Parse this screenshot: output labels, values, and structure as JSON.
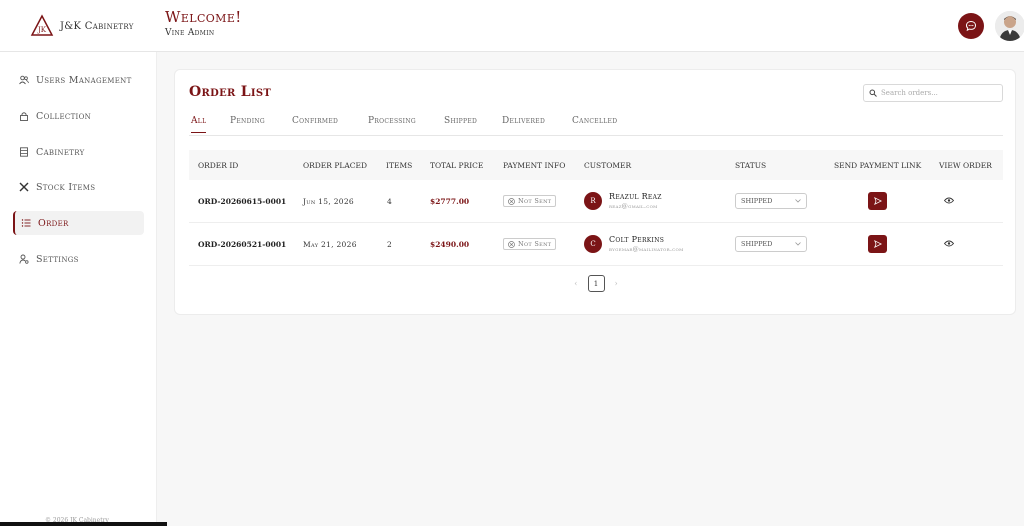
{
  "brand": {
    "name": "J&K Cabinetry"
  },
  "header": {
    "title": "Welcome!",
    "subtitle": "Vine Admin"
  },
  "sidebar": {
    "items": [
      {
        "label": "Users Management",
        "icon": "users-icon"
      },
      {
        "label": "Collection",
        "icon": "lock-icon"
      },
      {
        "label": "Cabinetry",
        "icon": "cabinet-icon"
      },
      {
        "label": "Stock Items",
        "icon": "tools-icon"
      },
      {
        "label": "Order",
        "icon": "list-icon",
        "active": true
      },
      {
        "label": "Settings",
        "icon": "user-settings-icon"
      }
    ],
    "footer": "© 2026 JK Cabinetry"
  },
  "main": {
    "title": "Order List",
    "search_placeholder": "Search orders...",
    "tabs": [
      "All",
      "Pending",
      "Confirmed",
      "Processing",
      "Shipped",
      "Delivered",
      "Cancelled"
    ],
    "active_tab": "All",
    "columns": [
      "ORDER ID",
      "ORDER PLACED",
      "ITEMS",
      "TOTAL PRICE",
      "PAYMENT INFO",
      "CUSTOMER",
      "STATUS",
      "SEND PAYMENT LINK",
      "VIEW ORDER"
    ],
    "rows": [
      {
        "order_id": "ORD-20260615-0001",
        "placed": "Jun 15, 2026",
        "items": "4",
        "total": "$2777.00",
        "payment": "Not Sent",
        "customer_initial": "R",
        "customer_name": "Reazul Reaz",
        "customer_email": "reaz@gmail.com",
        "status": "SHIPPED"
      },
      {
        "order_id": "ORD-20260521-0001",
        "placed": "May 21, 2026",
        "items": "2",
        "total": "$2490.00",
        "payment": "Not Sent",
        "customer_initial": "C",
        "customer_name": "Colt Perkins",
        "customer_email": "bygemar@mailinator.com",
        "status": "SHIPPED"
      }
    ],
    "pagination": {
      "current": "1",
      "prev": "‹",
      "next": "›"
    }
  },
  "colors": {
    "accent": "#7b1416",
    "background": "#f7f7f7"
  }
}
